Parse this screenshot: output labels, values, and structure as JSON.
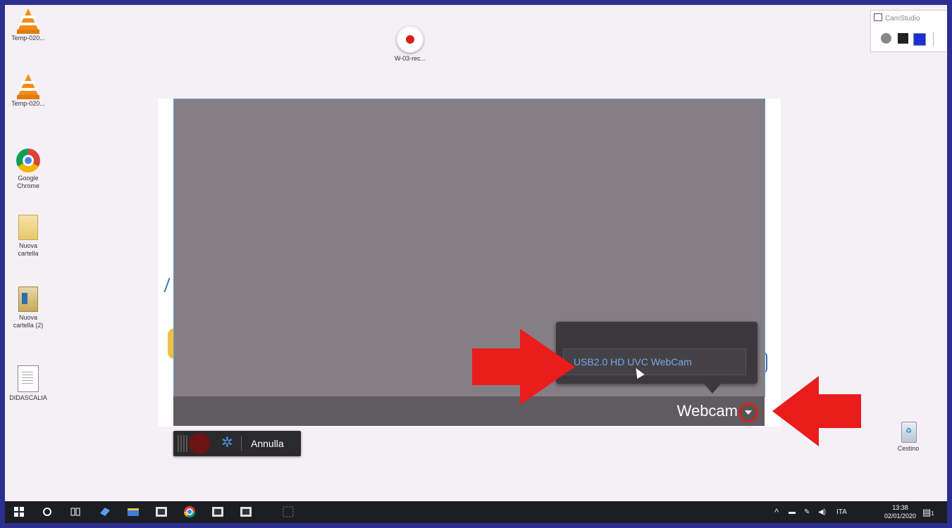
{
  "desktop": {
    "icons": [
      {
        "label": "Temp-020...",
        "type": "vlc-icon"
      },
      {
        "label": "Temp-020...",
        "type": "vlc-icon"
      },
      {
        "label": "Google Chrome",
        "type": "chrome-icon"
      },
      {
        "label": "Nuova cartella",
        "type": "folder-icon"
      },
      {
        "label": "Nuova cartella (2)",
        "type": "folder-icon"
      },
      {
        "label": "DIDASCALIA",
        "type": "document-icon"
      },
      {
        "label": "W-03-rec...",
        "type": "record-icon"
      },
      {
        "label": "Cestino",
        "type": "recycle-bin-icon"
      }
    ]
  },
  "camstudio": {
    "title": "CamStudio"
  },
  "webcam": {
    "label": "Webcam",
    "device_option": "USB2.0 HD UVC WebCam"
  },
  "record_bar": {
    "cancel_label": "Annulla"
  },
  "taskbar": {
    "language": "ITA",
    "time": "13:38",
    "date": "02/01/2020",
    "notification_count": "1"
  },
  "colors": {
    "highlight": "#d92020",
    "frame": "#2b2f8f"
  }
}
